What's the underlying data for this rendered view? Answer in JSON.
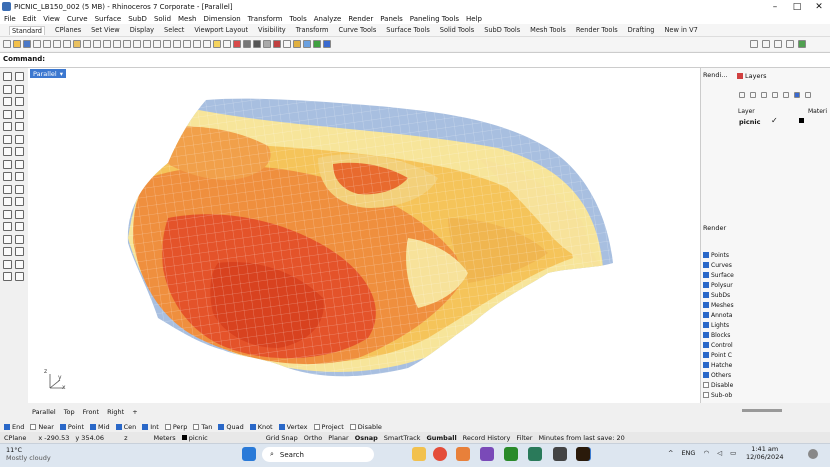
{
  "window": {
    "title": "PICNIC_LB150_002 (5 MB) - Rhinoceros 7 Corporate - [Parallel]"
  },
  "menu": [
    "File",
    "Edit",
    "View",
    "Curve",
    "Surface",
    "SubD",
    "Solid",
    "Mesh",
    "Dimension",
    "Transform",
    "Tools",
    "Analyze",
    "Render",
    "Panels",
    "Paneling Tools",
    "Help"
  ],
  "toolbar_tabs": [
    "Standard",
    "CPlanes",
    "Set View",
    "Display",
    "Select",
    "Viewport Layout",
    "Visibility",
    "Transform",
    "Curve Tools",
    "Surface Tools",
    "Solid Tools",
    "SubD Tools",
    "Mesh Tools",
    "Render Tools",
    "Drafting",
    "New in V7"
  ],
  "command": {
    "label": "Command:"
  },
  "viewport": {
    "name": "Parallel",
    "axis_y": "y",
    "axis_x": "x",
    "axis_z": "z"
  },
  "right_panel": {
    "render_tab": "Rendi...",
    "layers_tab": "Layers",
    "layer_col": "Layer",
    "material_col": "Materi",
    "layer_name": "picnic",
    "render_label": "Render"
  },
  "display_items": [
    {
      "label": "Points",
      "checked": true
    },
    {
      "label": "Curves",
      "checked": true
    },
    {
      "label": "Surface",
      "checked": true
    },
    {
      "label": "Polysur",
      "checked": true
    },
    {
      "label": "SubDs",
      "checked": true
    },
    {
      "label": "Meshes",
      "checked": true
    },
    {
      "label": "Annota",
      "checked": true
    },
    {
      "label": "Lights",
      "checked": true
    },
    {
      "label": "Blocks",
      "checked": true
    },
    {
      "label": "Control",
      "checked": true
    },
    {
      "label": "Point C",
      "checked": true
    },
    {
      "label": "Hatche",
      "checked": true
    },
    {
      "label": "Others",
      "checked": true
    },
    {
      "label": "Disable",
      "checked": false
    },
    {
      "label": "Sub-ob",
      "checked": false
    }
  ],
  "view_tabs": [
    "Parallel",
    "Top",
    "Front",
    "Right"
  ],
  "osnap": [
    {
      "label": "End",
      "checked": true
    },
    {
      "label": "Near",
      "checked": false
    },
    {
      "label": "Point",
      "checked": true
    },
    {
      "label": "Mid",
      "checked": true
    },
    {
      "label": "Cen",
      "checked": true
    },
    {
      "label": "Int",
      "checked": true
    },
    {
      "label": "Perp",
      "checked": false
    },
    {
      "label": "Tan",
      "checked": false
    },
    {
      "label": "Quad",
      "checked": true
    },
    {
      "label": "Knot",
      "checked": true
    },
    {
      "label": "Vertex",
      "checked": true
    },
    {
      "label": "Project",
      "checked": false
    },
    {
      "label": "Disable",
      "checked": false
    }
  ],
  "status": {
    "cplane": "CPlane",
    "x": "x -290.53",
    "y": "y 354.06",
    "z": "z",
    "units": "Meters",
    "layer": "picnic",
    "items": [
      "Grid Snap",
      "Ortho",
      "Planar",
      "Osnap",
      "SmartTrack",
      "Gumball",
      "Record History",
      "Filter",
      "Minutes from last save: 20"
    ]
  },
  "taskbar": {
    "temp": "11°C",
    "weather": "Mostly cloudy",
    "search": "Search",
    "lang": "ENG",
    "time": "1:41 am",
    "date": "12/06/2024"
  },
  "colors": {
    "accent": "#3c78d0"
  }
}
